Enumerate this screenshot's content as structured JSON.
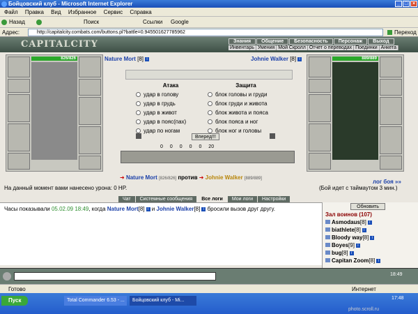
{
  "window": {
    "title": "Бойцовский клуб - Microsoft Internet Explorer"
  },
  "menu": [
    "Файл",
    "Правка",
    "Вид",
    "Избранное",
    "Сервис",
    "Справка"
  ],
  "toolbar": {
    "back": "Назад",
    "search": "Поиск",
    "links": "Ссылки",
    "google": "Google"
  },
  "address": {
    "label": "Адрес:",
    "url": "http://capitalcity.combats.com/buttons.pl?battle=0.945501627785962",
    "go": "Переход"
  },
  "game": {
    "logo": "CAPITALCITY",
    "nav_top": [
      "Знания",
      "Общение",
      "Безопасность",
      "Персонаж",
      "Выход"
    ],
    "nav_sub": [
      "Инвентарь",
      "Умения",
      "Мой Скролл",
      "Отчет о переводах",
      "Поединки",
      "Анкета"
    ],
    "player1": {
      "name": "Nature Mort",
      "level": "[8]",
      "hp": "826/826"
    },
    "player2": {
      "name": "Johnie Walker",
      "level": "[8]",
      "hp": "889/889"
    },
    "attack": {
      "title": "Атака",
      "options": [
        "удар в голову",
        "удар в грудь",
        "удар в живот",
        "удар в пояс(пах)",
        "удар по ногам"
      ]
    },
    "defense": {
      "title": "Защита",
      "options": [
        "блок головы и груди",
        "блок груди и живота",
        "блок живота и пояса",
        "блок пояса и ног",
        "блок ног и головы"
      ]
    },
    "forward_button": "Вперед!!!",
    "counters": [
      "0",
      "0",
      "0",
      "0",
      "0",
      "20"
    ],
    "versus": {
      "left": "Nature Mort",
      "left_hp": "[826/826]",
      "mid": "против",
      "right": "Johnie Walker",
      "right_hp": "[889/889]"
    },
    "damage_text": "На данный момент вами нанесено урона: 0 HP.",
    "log_link": "лог боя »»",
    "timeout_text": "(Бой идет с таймаутом 3 мин.)",
    "tabs": [
      "Чат",
      "Системные сообщения",
      "Все логи",
      "Мои логи",
      "Настройки"
    ],
    "log": {
      "prefix": "Часы показывали",
      "timestamp": "05.02.09 18:49",
      "mid": ", когда",
      "p1": "Nature Mort",
      "lvl1": "[8]",
      "and": "и",
      "p2": "Johnie Walker",
      "lvl2": "[8]",
      "suffix": "бросили вызов друг другу."
    },
    "refresh_button": "Обновить",
    "warriors_header": "Зал воинов (107)",
    "warriors": [
      {
        "name": "Asmodaus",
        "lvl": "[8]"
      },
      {
        "name": "biathlete",
        "lvl": "[8]"
      },
      {
        "name": "Bloody way",
        "lvl": "[8]"
      },
      {
        "name": "Boyes",
        "lvl": "[9]"
      },
      {
        "name": "bug",
        "lvl": "[8]"
      },
      {
        "name": "Capitan Zoom",
        "lvl": "[8]"
      }
    ],
    "clock": "18:49"
  },
  "statusbar": {
    "ready": "Готово",
    "zone": "Интернет"
  },
  "taskbar": {
    "start": "Пуск",
    "tasks": [
      "Total Commander 6.53 - ...",
      "Бойцовский клуб - Mi..."
    ],
    "time": "17:48",
    "watermark": "photo.scroll.ru"
  }
}
